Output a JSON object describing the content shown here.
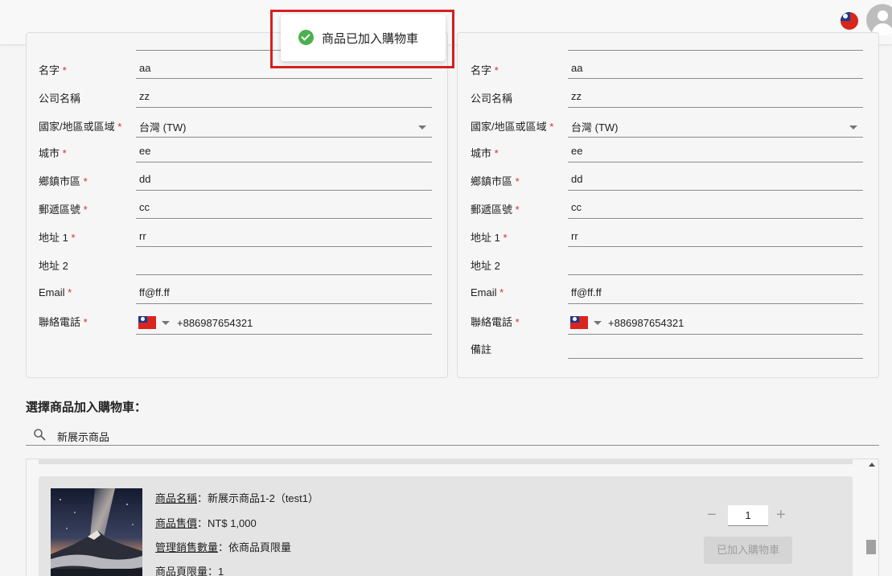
{
  "header": {
    "language_flag_icon": "taiwan-flag-icon",
    "avatar_icon": "user-avatar-icon"
  },
  "toast": {
    "message": "商品已加入購物車",
    "icon": "check-circle-icon",
    "color": "#4caf50"
  },
  "left_form": {
    "name_label": "名字",
    "name_value": "aa",
    "company_label": "公司名稱",
    "company_value": "zz",
    "country_label": "國家/地區或區域",
    "country_value": "台灣 (TW)",
    "city_label": "城市",
    "city_value": "ee",
    "district_label": "鄉鎮市區",
    "district_value": "dd",
    "postal_label": "郵遞區號",
    "postal_value": "cc",
    "address1_label": "地址 1",
    "address1_value": "rr",
    "address2_label": "地址 2",
    "address2_value": "",
    "email_label": "Email",
    "email_value": "ff@ff.ff",
    "phone_label": "聯絡電話",
    "phone_value": "+886987654321"
  },
  "right_form": {
    "name_label": "名字",
    "name_value": "aa",
    "company_label": "公司名稱",
    "company_value": "zz",
    "country_label": "國家/地區或區域",
    "country_value": "台灣 (TW)",
    "city_label": "城市",
    "city_value": "ee",
    "district_label": "鄉鎮市區",
    "district_value": "dd",
    "postal_label": "郵遞區號",
    "postal_value": "cc",
    "address1_label": "地址 1",
    "address1_value": "rr",
    "address2_label": "地址 2",
    "address2_value": "",
    "email_label": "Email",
    "email_value": "ff@ff.ff",
    "phone_label": "聯絡電話",
    "phone_value": "+886987654321",
    "note_label": "備註",
    "note_value": ""
  },
  "required_mark": "*",
  "colors": {
    "required": "#d32f2f",
    "toast_highlight": "#d42020"
  },
  "product_section": {
    "title": "選擇商品加入購物車：",
    "search_value": "新展示商品",
    "product": {
      "name_label": "商品名稱",
      "name_value": "新展示商品1-2（test1）",
      "price_label": "商品售價",
      "price_value": "NT$ 1,000",
      "sales_label": "管理銷售數量",
      "sales_value": "依商品頁限量",
      "limit_label": "商品頁限量",
      "limit_value": "1",
      "separator": "：",
      "quantity": "1",
      "minus": "−",
      "plus": "+",
      "added_button": "已加入購物車"
    }
  }
}
